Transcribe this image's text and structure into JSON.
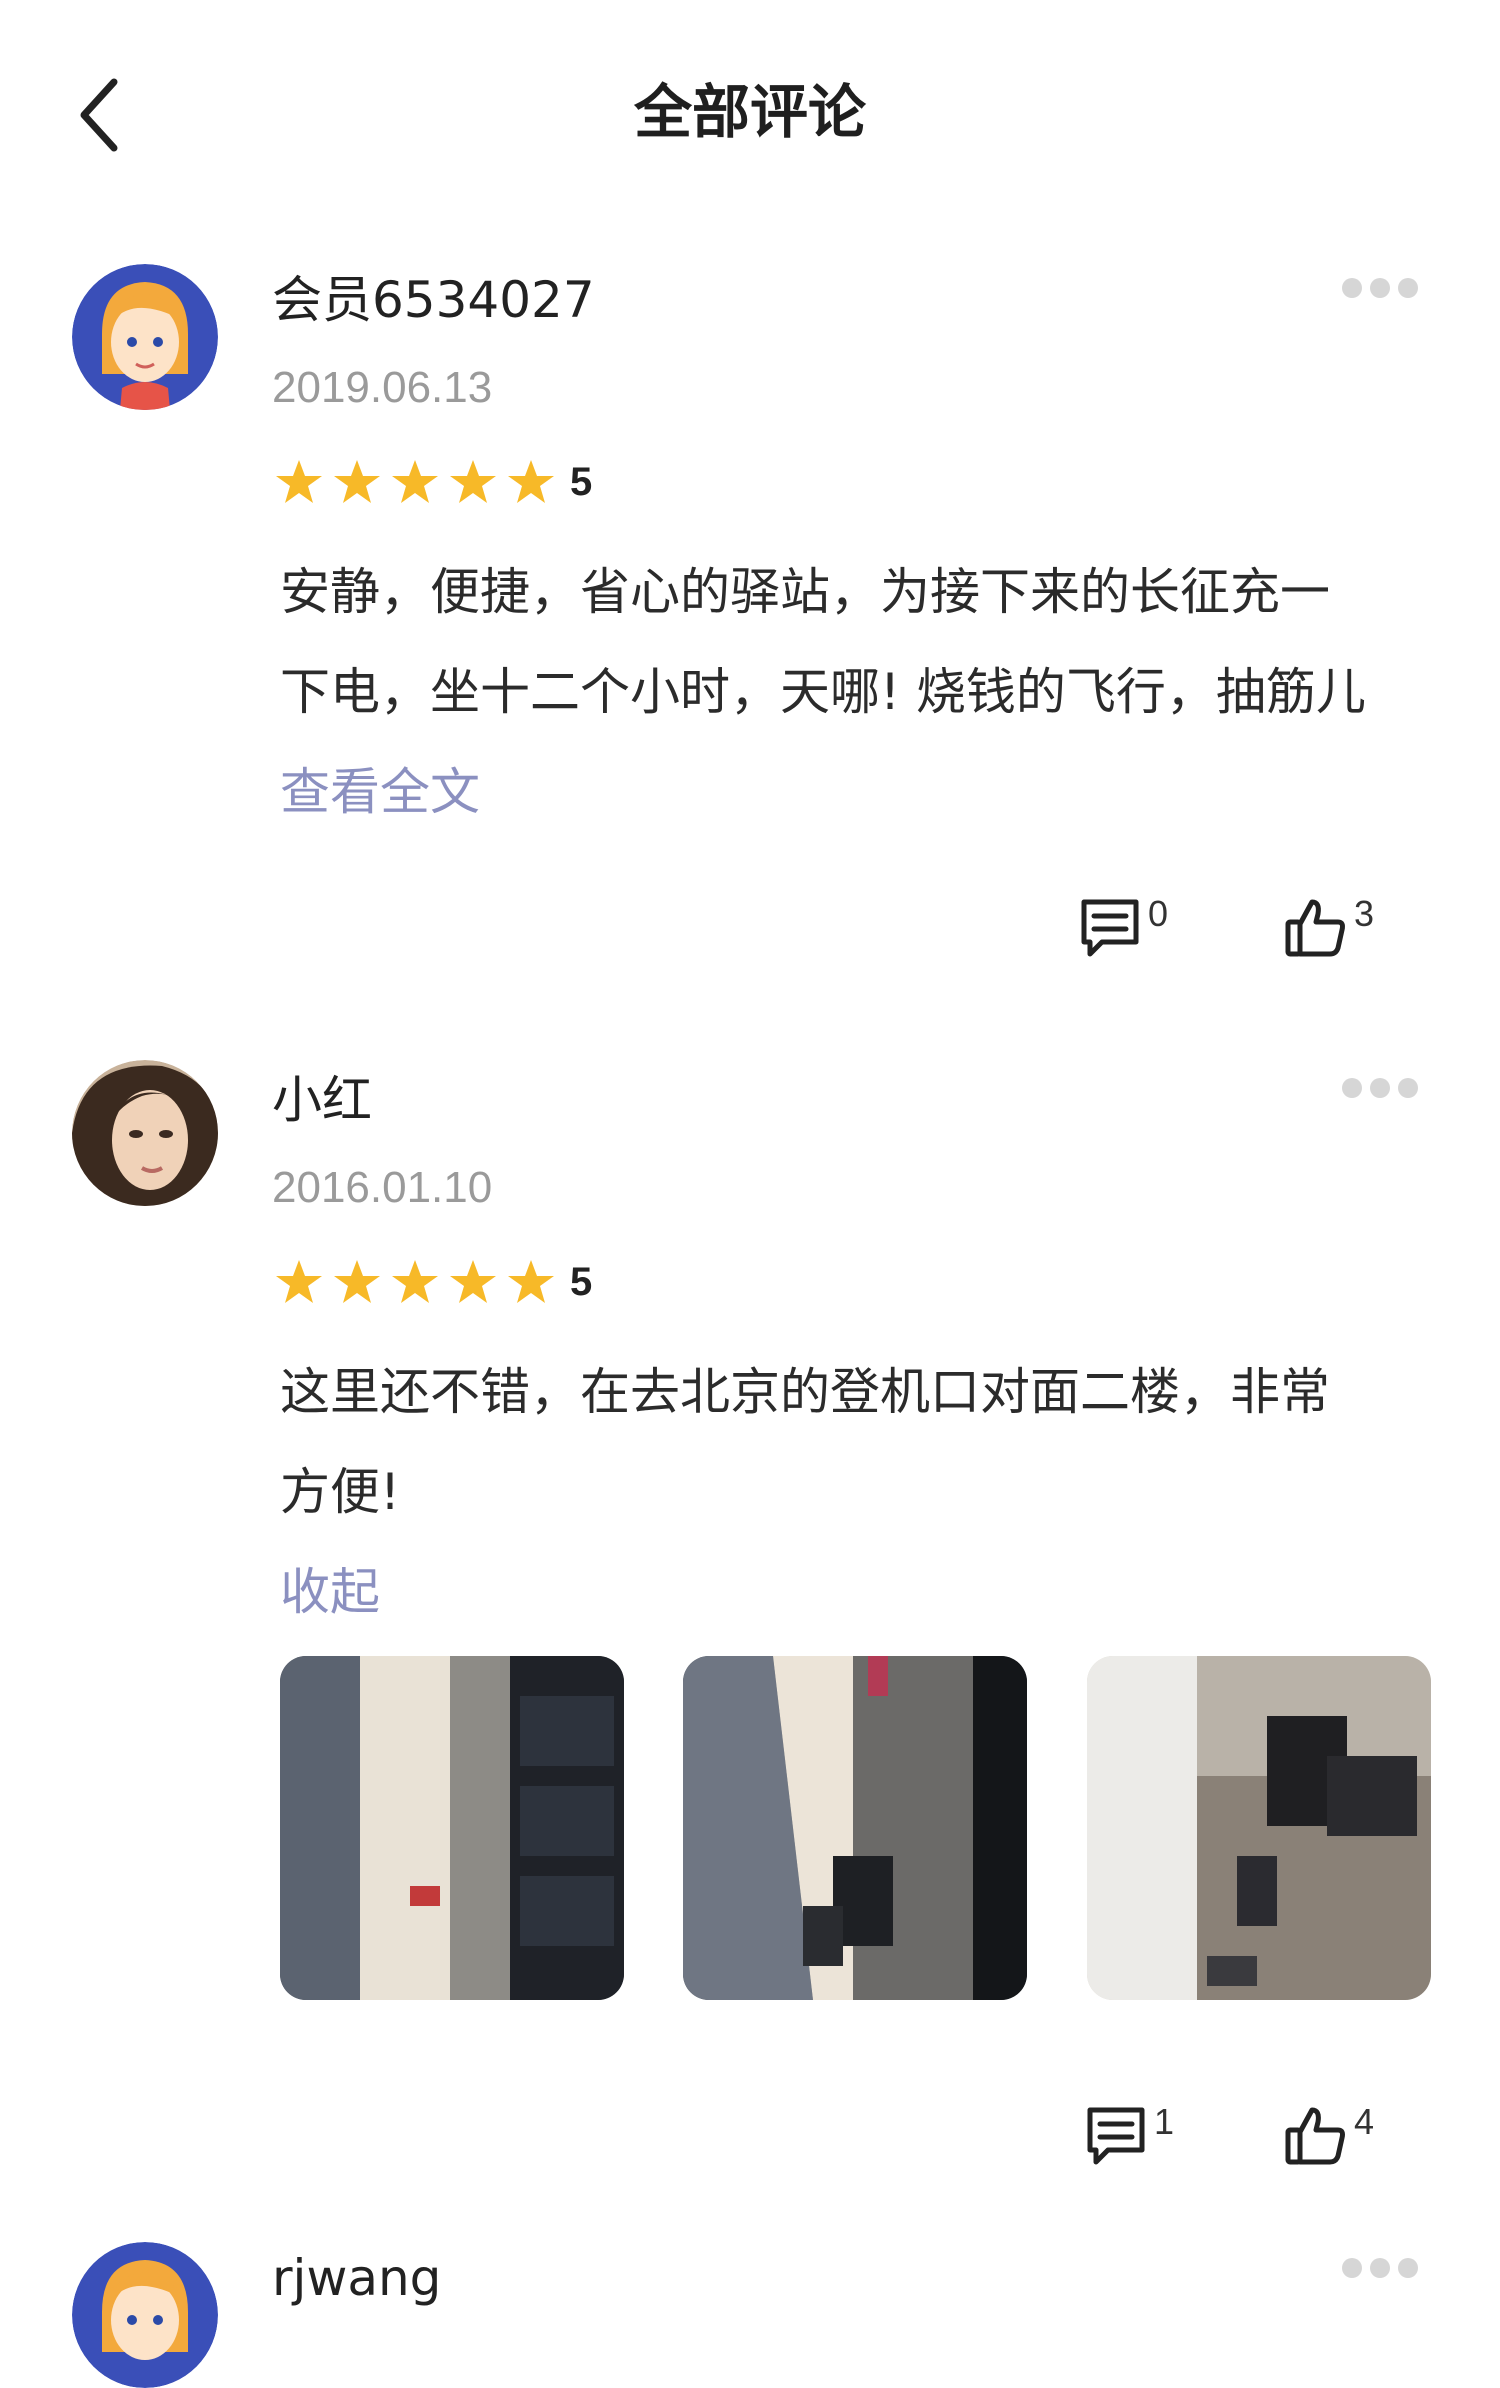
{
  "header": {
    "title": "全部评论"
  },
  "reviews": [
    {
      "username": "会员6534027",
      "date": "2019.06.13",
      "rating": "5",
      "text_lines": [
        "安静，便捷，省心的驿站，为接下来的长征充一",
        "下电，坐十二个小时，天哪! 烧钱的飞行，抽筋儿"
      ],
      "toggle": "查看全文",
      "comment_count": "0",
      "like_count": "3"
    },
    {
      "username": "小红",
      "date": "2016.01.10",
      "rating": "5",
      "text_lines": [
        "这里还不错，在去北京的登机口对面二楼，非常",
        "方便!"
      ],
      "toggle": "收起",
      "comment_count": "1",
      "like_count": "4"
    },
    {
      "username": "rjwang"
    }
  ],
  "colors": {
    "star": "#f7b928",
    "link": "#8b90c0",
    "avatar_bg": "#3a4fb8"
  },
  "icons": [
    "back-icon",
    "more-icon",
    "star-icon",
    "comment-icon",
    "thumbs-up-icon"
  ]
}
